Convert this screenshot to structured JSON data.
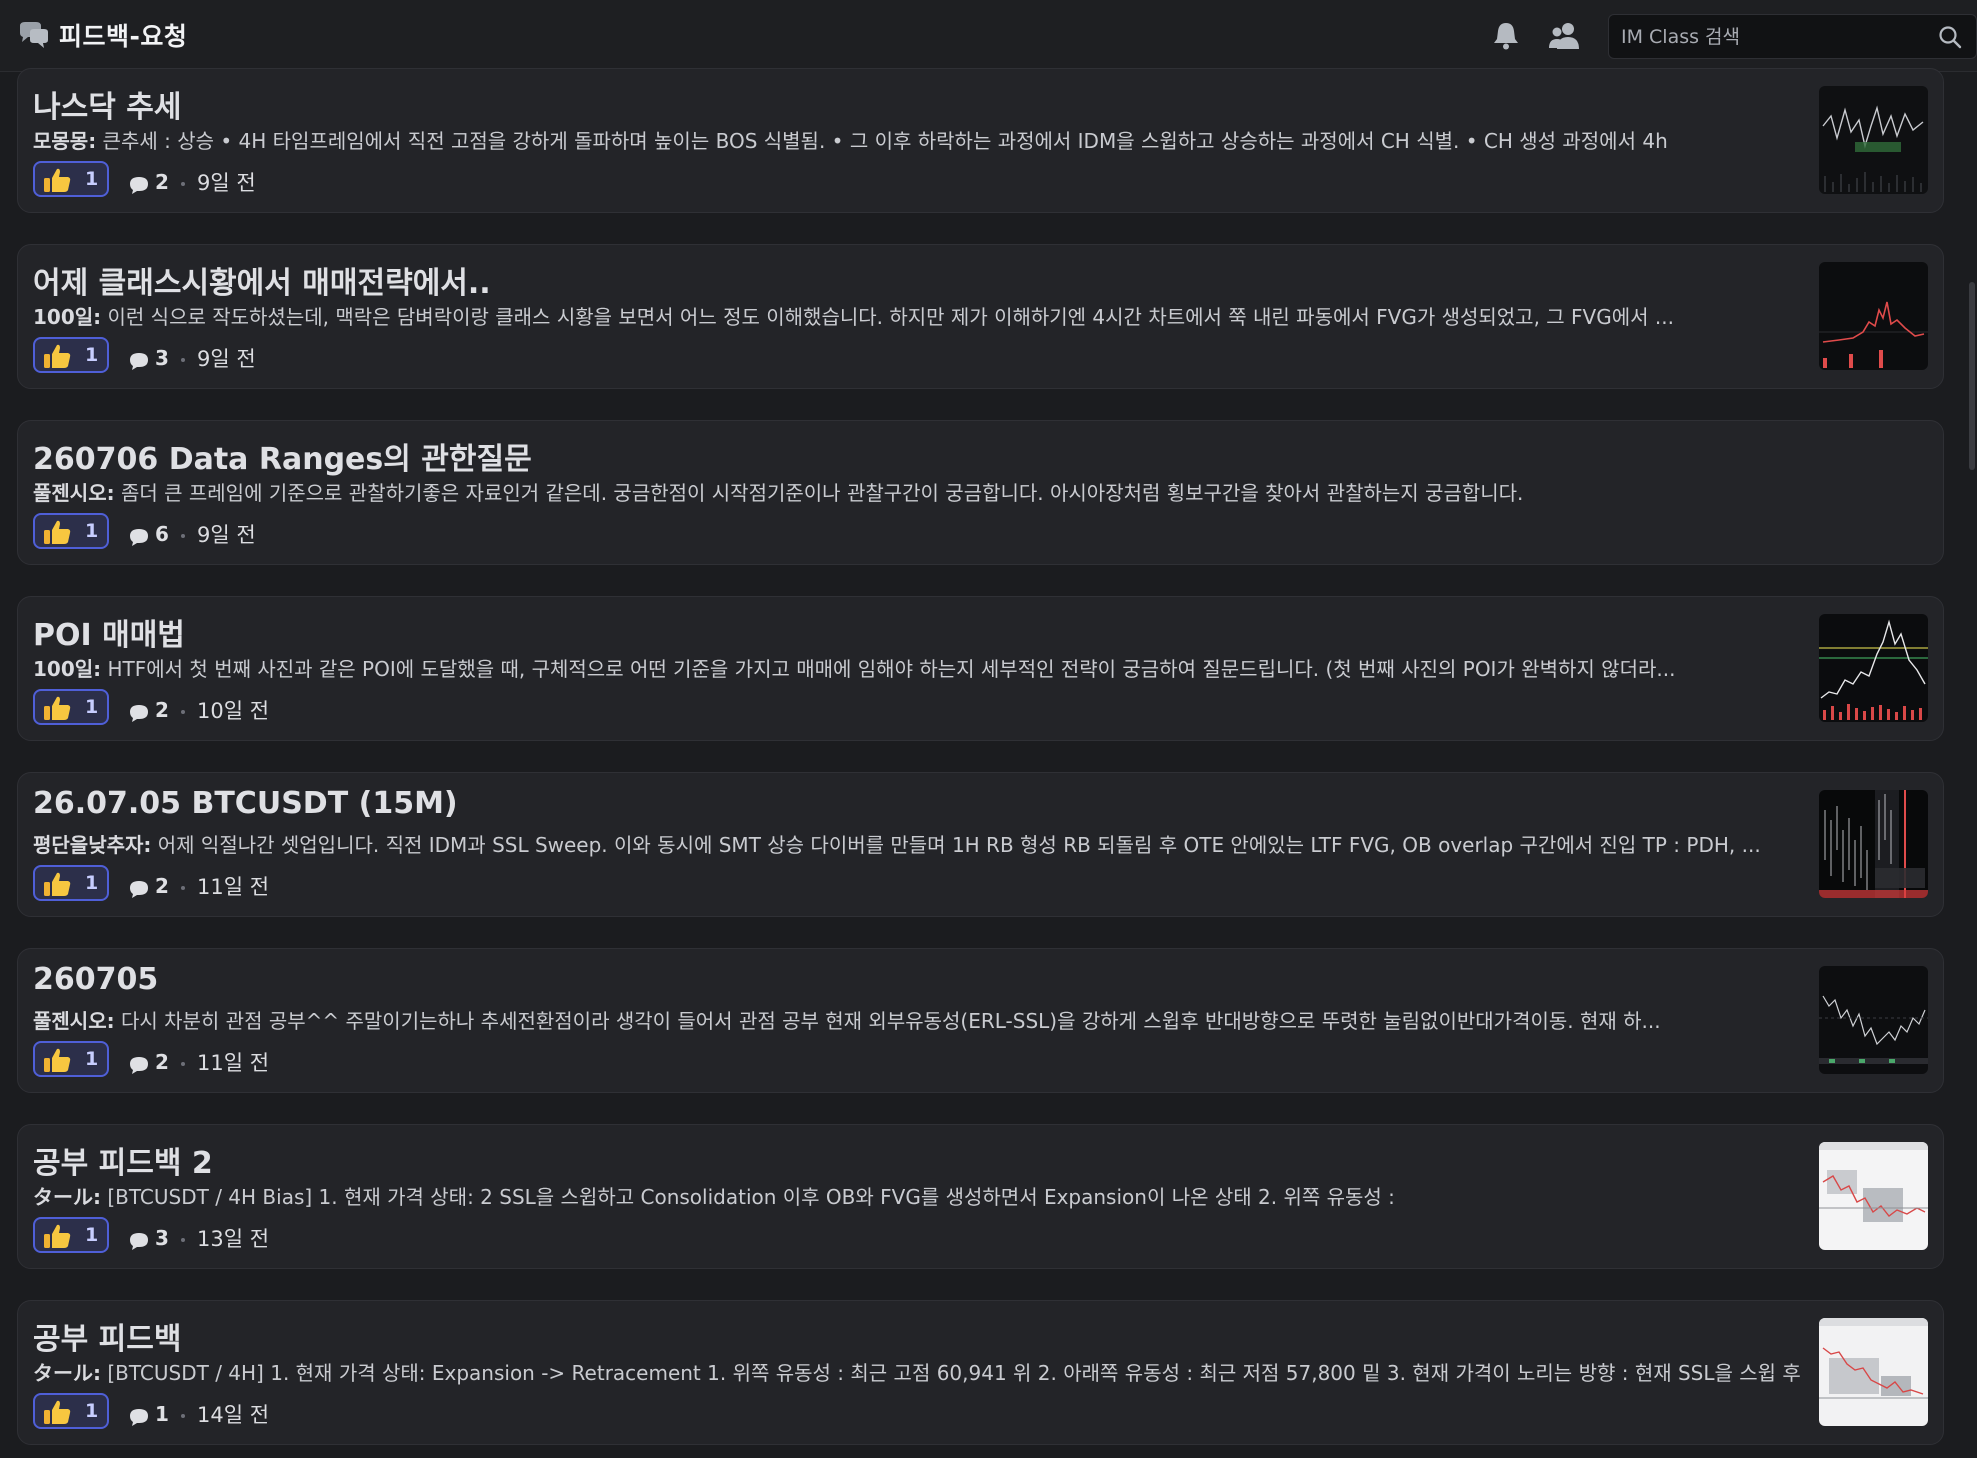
{
  "header": {
    "channel_title": "피드백-요청",
    "search_placeholder": "IM Class 검색"
  },
  "posts": [
    {
      "title": "나스닥 추세",
      "author": "모몽몽:",
      "excerpt": " 큰추세 : 상승 • 4H 타임프레임에서 직전 고점을 강하게 돌파하며 높이는 BOS 식별됨.  • 그 이후 하락하는 과정에서 IDM을 스윕하고 상승하는 과정에서 CH 식별.  • CH 생성 과정에서 4h",
      "reactions": "1",
      "comments": "2",
      "time": "9일 전"
    },
    {
      "title": "어제 클래스시황에서 매매전략에서..",
      "author": "100일:",
      "excerpt": " 이런 식으로 작도하셨는데, 맥락은 담벼락이랑 클래스 시황을 보면서 어느 정도 이해했습니다. 하지만 제가 이해하기엔 4시간 차트에서 쭉 내린 파동에서 FVG가 생성되었고, 그 FVG에서 ...",
      "reactions": "1",
      "comments": "3",
      "time": "9일 전"
    },
    {
      "title": "260706 Data Ranges의 관한질문",
      "author": "풀젠시오:",
      "excerpt": " 좀더 큰 프레임에 기준으로 관찰하기좋은 자료인거 같은데. 궁금한점이 시작점기준이나 관찰구간이 궁금합니다. 아시아장처럼 횡보구간을 찾아서 관찰하는지 궁금합니다.",
      "reactions": "1",
      "comments": "6",
      "time": "9일 전"
    },
    {
      "title": "POI 매매법",
      "author": "100일:",
      "excerpt": " HTF에서 첫 번째 사진과 같은 POI에 도달했을 때, 구체적으로 어떤 기준을 가지고 매매에 임해야 하는지 세부적인 전략이 궁금하여 질문드립니다. (첫 번째 사진의 POI가 완벽하지 않더라...",
      "reactions": "1",
      "comments": "2",
      "time": "10일 전"
    },
    {
      "title": "26.07.05 BTCUSDT (15M)",
      "author": "평단을낮추자:",
      "excerpt": " 어제 익절나간 셋업입니다. 직전 IDM과 SSL Sweep. 이와 동시에 SMT 상승 다이버를 만들며 1H RB 형성 RB 되돌림 후 OTE 안에있는 LTF FVG, OB overlap 구간에서 진입 TP : PDH, ...",
      "reactions": "1",
      "comments": "2",
      "time": "11일 전"
    },
    {
      "title": "260705",
      "author": "풀젠시오:",
      "excerpt": " 다시 차분히 관점 공부^^ 주말이기는하나 추세전환점이라 생각이 들어서 관점 공부 현재 외부유동성(ERL-SSL)을 강하게 스윕후 반대방향으로 뚜렷한 눌림없이반대가격이동. 현재 하...",
      "reactions": "1",
      "comments": "2",
      "time": "11일 전"
    },
    {
      "title": "공부 피드백 2",
      "author": "タール:",
      "excerpt": " [BTCUSDT / 4H Bias] 1. 현재 가격 상태: 2 SSL을 스윕하고 Consolidation 이후 OB와 FVG를 생성하면서 Expansion이 나온 상태  2. 위쪽 유동성 :",
      "reactions": "1",
      "comments": "3",
      "time": "13일 전"
    },
    {
      "title": "공부 피드백",
      "author": "タール:",
      "excerpt": " [BTCUSDT / 4H] 1. 현재 가격 상태: Expansion -> Retracement 1. 위쪽 유동성 : 최근 고점 60,941 위  2. 아래쪽 유동성 : 최근 저점 57,800 밑  3. 현재 가격이 노리는 방향 : 현재 SSL을 스윕 후",
      "reactions": "1",
      "comments": "1",
      "time": "14일 전"
    }
  ],
  "colors": {
    "background": "#1b1c1f",
    "card": "#232428",
    "reaction_border": "#4f5fd8",
    "reaction_bg": "#2c2f4a"
  }
}
